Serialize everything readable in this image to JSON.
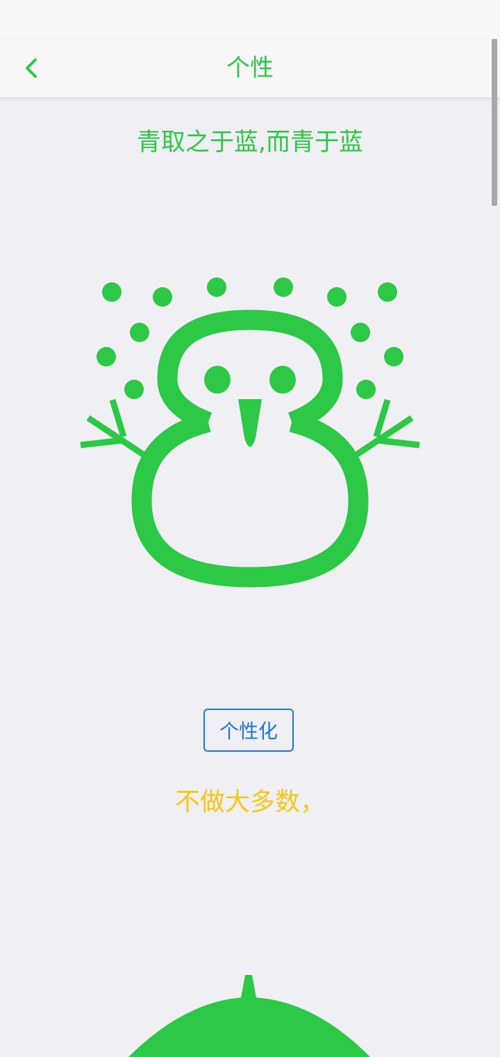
{
  "header": {
    "title": "个性",
    "back_icon": "chevron-left-icon"
  },
  "main": {
    "headline": "青取之于蓝,而青于蓝",
    "illustration_icon": "snowman-icon",
    "personalize_button_label": "个性化",
    "slogan": "不做大多数，",
    "bottom_illustration_icon": "snowman-head-icon"
  },
  "colors": {
    "accent_green": "#2dc845",
    "button_blue": "#1e74e6",
    "slogan_yellow": "#f5c817",
    "background": "#efeff4",
    "header_background": "#f7f7f7"
  }
}
